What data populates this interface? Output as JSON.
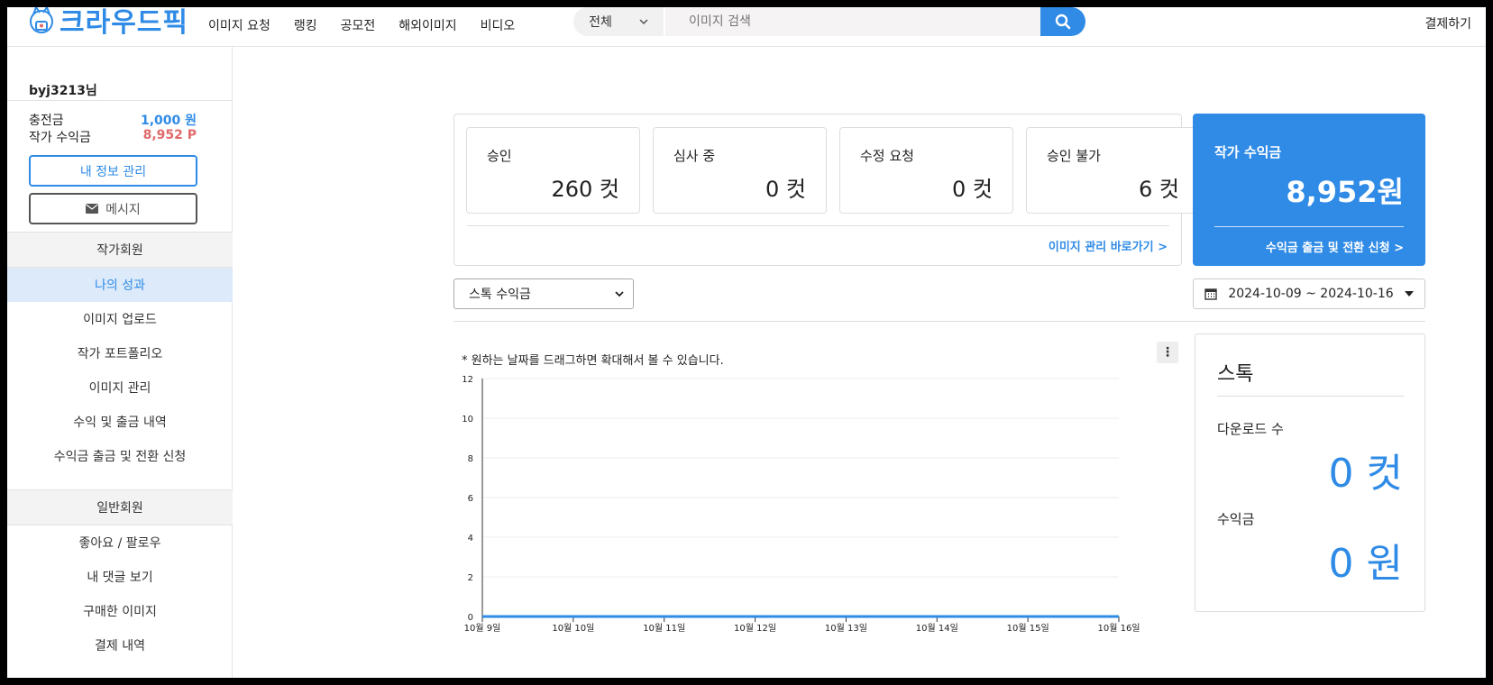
{
  "header": {
    "logo_text": "크라우드픽",
    "nav": [
      "이미지 요청",
      "랭킹",
      "공모전",
      "해외이미지",
      "비디오"
    ],
    "search_category": "전체",
    "search_placeholder": "이미지 검색",
    "pay_link": "결제하기"
  },
  "sidebar": {
    "user_name": "byj3213님",
    "charge_label": "충전금",
    "charge_value": "1,000 원",
    "earn_label": "작가 수익금",
    "earn_value": "8,952 P",
    "my_info_button": "내 정보 관리",
    "message_button": "메시지",
    "section_author": "작가회원",
    "author_items": [
      "나의 성과",
      "이미지 업로드",
      "작가 포트폴리오",
      "이미지 관리",
      "수익 및 출금 내역",
      "수익금 출금 및 전환 신청"
    ],
    "section_general": "일반회원",
    "general_items": [
      "좋아요 / 팔로우",
      "내 댓글 보기",
      "구매한 이미지",
      "결제 내역"
    ]
  },
  "stats": {
    "cards": [
      {
        "label": "승인",
        "value": "260 컷"
      },
      {
        "label": "심사 중",
        "value": "0 컷"
      },
      {
        "label": "수정 요청",
        "value": "0 컷"
      },
      {
        "label": "승인 불가",
        "value": "6 컷"
      }
    ],
    "image_manage_link": "이미지 관리 바로가기 >"
  },
  "earnings": {
    "label": "작가 수익금",
    "value": "8,952원",
    "link": "수익금 출금 및 전환 신청 >"
  },
  "filter": {
    "select_value": "스톡 수익금",
    "date_range": "2024-10-09 ~ 2024-10-16"
  },
  "chart_note": "* 원하는 날짜를 드래그하면 확대해서 볼 수 있습니다.",
  "chart_menu": "⋮",
  "chart_data": {
    "type": "line",
    "categories": [
      "10월 9일",
      "10월 10일",
      "10월 11일",
      "10월 12일",
      "10월 13일",
      "10월 14일",
      "10월 15일",
      "10월 16일"
    ],
    "values": [
      0,
      0,
      0,
      0,
      0,
      0,
      0,
      0
    ],
    "yticks": [
      "0",
      "2",
      "4",
      "6",
      "8",
      "10",
      "12"
    ],
    "ylim": [
      0,
      12
    ],
    "color": "#2f8be6"
  },
  "stock": {
    "title": "스톡",
    "downloads_label": "다운로드 수",
    "downloads_value": "0 컷",
    "revenue_label": "수익금",
    "revenue_value": "0 원"
  },
  "colors": {
    "accent": "#2f8be6",
    "point": "#e06a6a"
  }
}
